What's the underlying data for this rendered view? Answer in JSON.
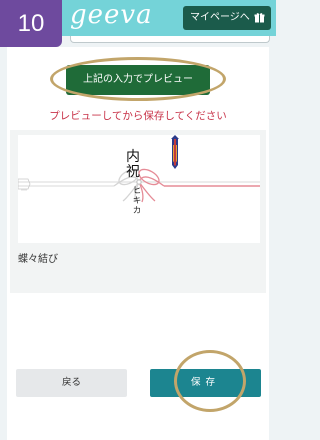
{
  "header": {
    "step_number": "10",
    "logo_text": "geeva",
    "mypage_label": "マイページへ"
  },
  "main": {
    "preview_button_label": "上記の入力でプレビュー",
    "warning_text": "プレビューしてから保存してください",
    "noshi": {
      "title_chars": [
        "内",
        "祝"
      ],
      "name_chars": [
        "ヒ",
        "キ",
        "カ"
      ]
    },
    "style_label": "蝶々結び"
  },
  "footer": {
    "back_label": "戻る",
    "save_label": "保存"
  },
  "colors": {
    "header_bg": "#74d3d8",
    "step_badge": "#6e4a9e",
    "mypage_button": "#1b5b4b",
    "preview_button": "#1f6b38",
    "warning_text": "#c8344a",
    "save_button": "#1c8590",
    "highlight_circle": "#c2a56a"
  },
  "icons": {
    "mypage": "gift-icon",
    "noshi_ornament": "noshi-ornament-icon"
  }
}
